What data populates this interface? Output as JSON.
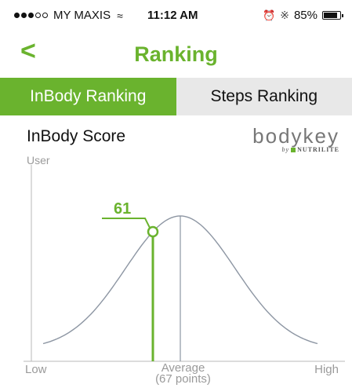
{
  "status_bar": {
    "carrier": "MY MAXIS",
    "signal_bars_filled": 3,
    "signal_bars_total": 5,
    "time": "11:12 AM",
    "battery_text": "85%",
    "battery_level": 0.85,
    "icons": [
      "wifi-icon",
      "alarm-icon",
      "bluetooth-icon",
      "battery-icon"
    ]
  },
  "nav": {
    "back_glyph": "<",
    "title": "Ranking"
  },
  "tabs": [
    {
      "label": "InBody Ranking",
      "active": true
    },
    {
      "label": "Steps Ranking",
      "active": false
    }
  ],
  "section": {
    "title": "InBody Score",
    "y_axis_label": "User"
  },
  "logo": {
    "word": "bodykey",
    "by": "by",
    "brand": "NUTRILITE"
  },
  "chart_data": {
    "type": "line",
    "user_score": 61,
    "average_score": 67,
    "x_labels": {
      "low": "Low",
      "average": "Average",
      "average_sub": "(67 points)",
      "high": "High"
    },
    "curve": "normal-distribution",
    "colors": {
      "accent": "#6ab32e",
      "curve": "#8d96a3",
      "axis": "#b8b8b8"
    }
  },
  "colors": {
    "accent": "#6ab32e",
    "tab_inactive_bg": "#e8e8e8"
  }
}
